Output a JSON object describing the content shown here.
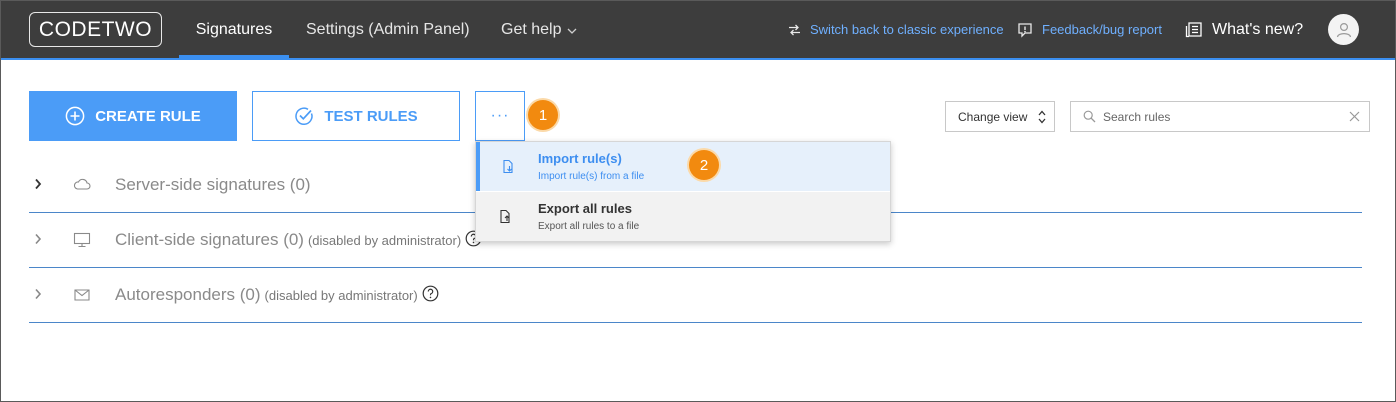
{
  "header": {
    "logo": "CODETWO",
    "nav": [
      {
        "label": "Signatures"
      },
      {
        "label": "Settings (Admin Panel)"
      },
      {
        "label": "Get help"
      }
    ],
    "switch_link": "Switch back to classic experience",
    "feedback_link": "Feedback/bug report",
    "whats_new": "What's new?"
  },
  "toolbar": {
    "create_label": "CREATE RULE",
    "test_label": "TEST RULES",
    "more_label": "···",
    "change_view": "Change view",
    "search_placeholder": "Search rules"
  },
  "annotations": {
    "badge_1": "1",
    "badge_2": "2"
  },
  "sections": [
    {
      "title": "Server-side signatures (0)",
      "note": ""
    },
    {
      "title": "Client-side signatures (0)",
      "note": "(disabled by administrator)"
    },
    {
      "title": "Autoresponders (0)",
      "note": "(disabled by administrator)"
    }
  ],
  "dropdown": {
    "items": [
      {
        "title": "Import rule(s)",
        "subtitle": "Import rule(s) from a file",
        "icon": "import-icon"
      },
      {
        "title": "Export all rules",
        "subtitle": "Export all rules to a file",
        "icon": "export-icon"
      }
    ]
  },
  "colors": {
    "topbar": "#3d3d3d",
    "accent": "#4b9cf7",
    "badge": "#f28a0f",
    "link": "#6fb0ff"
  }
}
